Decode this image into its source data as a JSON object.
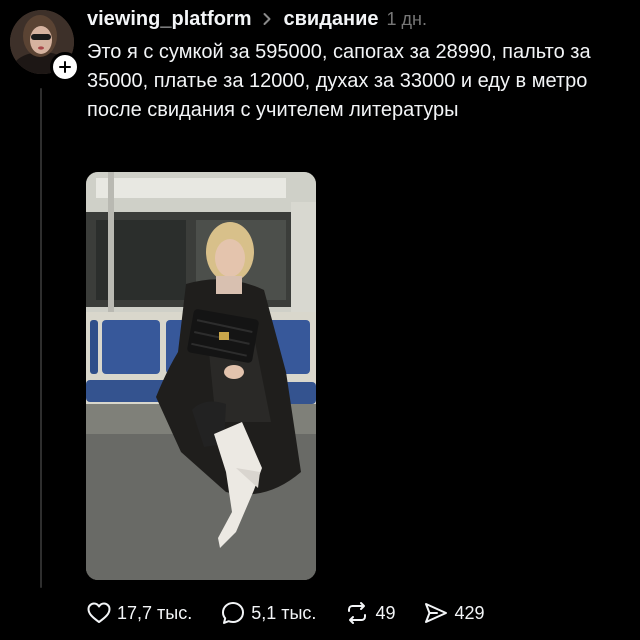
{
  "post": {
    "username": "viewing_platform",
    "topic": "свидание",
    "time": "1 дн.",
    "text": "Это я с сумкой за 595000, сапогах за 28990, пальто за 35000, платье за 12000, духах за 33000 и еду в метро после свидания с учителем литературы"
  },
  "actions": {
    "likes": "17,7 тыс.",
    "comments": "5,1 тыс.",
    "reposts": "49",
    "shares": "429"
  },
  "icons": {
    "follow": "plus-icon",
    "chevron": "chevron-right-icon",
    "like": "heart-icon",
    "comment": "speech-bubble-icon",
    "repost": "repost-icon",
    "share": "send-icon"
  },
  "colors": {
    "background": "#000000",
    "text": "#f3f5f7",
    "muted": "#777777"
  }
}
